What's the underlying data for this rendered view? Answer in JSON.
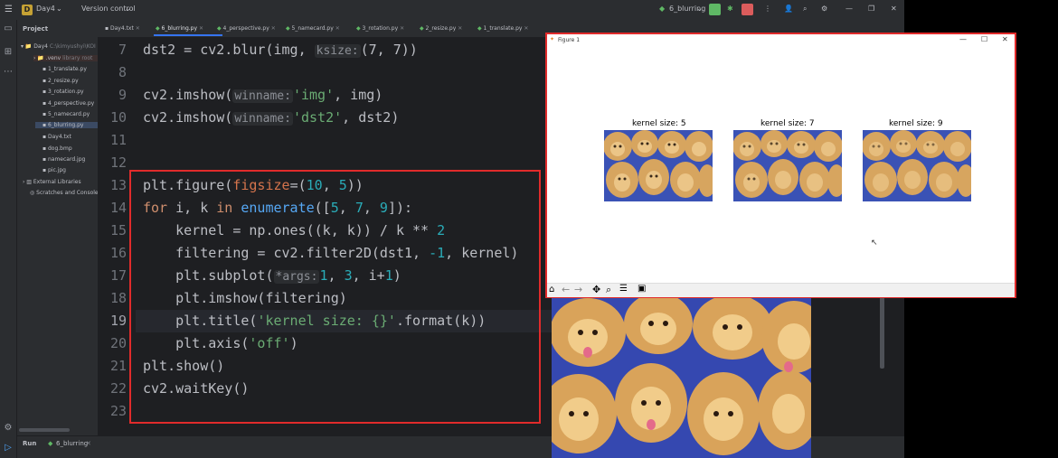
{
  "titlebar": {
    "project_badge": "D",
    "project_name": "Day4",
    "version_control": "Version control",
    "run_config": "6_blurring"
  },
  "project_pane": {
    "header": "Project",
    "items": [
      {
        "label": "Day4",
        "hint": "C:\\kimyushyi\\KOI"
      },
      {
        "label": ".venv",
        "hint": "library root"
      },
      {
        "label": "1_translate.py"
      },
      {
        "label": "2_resize.py"
      },
      {
        "label": "3_rotation.py"
      },
      {
        "label": "4_perspective.py"
      },
      {
        "label": "5_namecard.py"
      },
      {
        "label": "6_blurring.py"
      },
      {
        "label": "Day4.txt"
      },
      {
        "label": "dog.bmp"
      },
      {
        "label": "namecard.jpg"
      },
      {
        "label": "pic.jpg"
      },
      {
        "label": "External Libraries"
      },
      {
        "label": "Scratches and Consoles"
      }
    ]
  },
  "tabs": [
    {
      "label": "Day4.txt"
    },
    {
      "label": "6_blurring.py",
      "active": true
    },
    {
      "label": "4_perspective.py"
    },
    {
      "label": "5_namecard.py"
    },
    {
      "label": "3_rotation.py"
    },
    {
      "label": "2_resize.py"
    },
    {
      "label": "1_translate.py"
    }
  ],
  "editor": {
    "line_numbers": [
      "7",
      "8",
      "9",
      "10",
      "11",
      "12",
      "13",
      "14",
      "15",
      "16",
      "17",
      "18",
      "19",
      "20",
      "21",
      "22",
      "23"
    ],
    "current_line": "19",
    "hints": {
      "ksize": "ksize:",
      "winname": "winname:",
      "args": "*args:"
    },
    "code": {
      "l7a": "dst2 = cv2.blur(img, ",
      "l7b": "(7, 7))",
      "l9a": "cv2.imshow(",
      "l9b": "'img'",
      "l9c": ", img)",
      "l10a": "cv2.imshow(",
      "l10b": "'dst2'",
      "l10c": ", dst2)",
      "l13a": "plt.figure(",
      "l13b": "figsize",
      "l13c": "=(",
      "l13d": "10",
      "l13e": ", ",
      "l13f": "5",
      "l13g": "))",
      "l14a": "for",
      "l14b": " i, k ",
      "l14c": "in",
      "l14d": " ",
      "l14e": "enumerate",
      "l14f": "([",
      "l14g": "5",
      "l14h": ", ",
      "l14i": "7",
      "l14j": ", ",
      "l14k": "9",
      "l14l": "]):",
      "l15a": "    kernel = np.ones((k, k)) / k ** ",
      "l15b": "2",
      "l16a": "    filtering = cv2.filter2D(dst1, ",
      "l16b": "-1",
      "l16c": ", kernel)",
      "l17a": "    plt.subplot(",
      "l17b": "1",
      "l17c": ", ",
      "l17d": "3",
      "l17e": ", i+",
      "l17f": "1",
      "l17g": ")",
      "l18": "    plt.imshow(filtering)",
      "l19a": "    plt.title(",
      "l19b": "'kernel size: {}'",
      "l19c": ".format(k))",
      "l20a": "    plt.axis(",
      "l20b": "'off'",
      "l20c": ")",
      "l21": "plt.show()",
      "l22": "cv2.waitKey()"
    }
  },
  "run_bar": {
    "label": "Run",
    "config": "6_blurring"
  },
  "figure": {
    "window_title": "Figure 1",
    "subplot_titles": [
      "kernel size: 5",
      "kernel size: 7",
      "kernel size: 9"
    ]
  },
  "colors": {
    "accent": "#3574f0",
    "highlight_red": "#e12b2b",
    "run_green": "#5fb865",
    "stop_red": "#db5c5c"
  }
}
